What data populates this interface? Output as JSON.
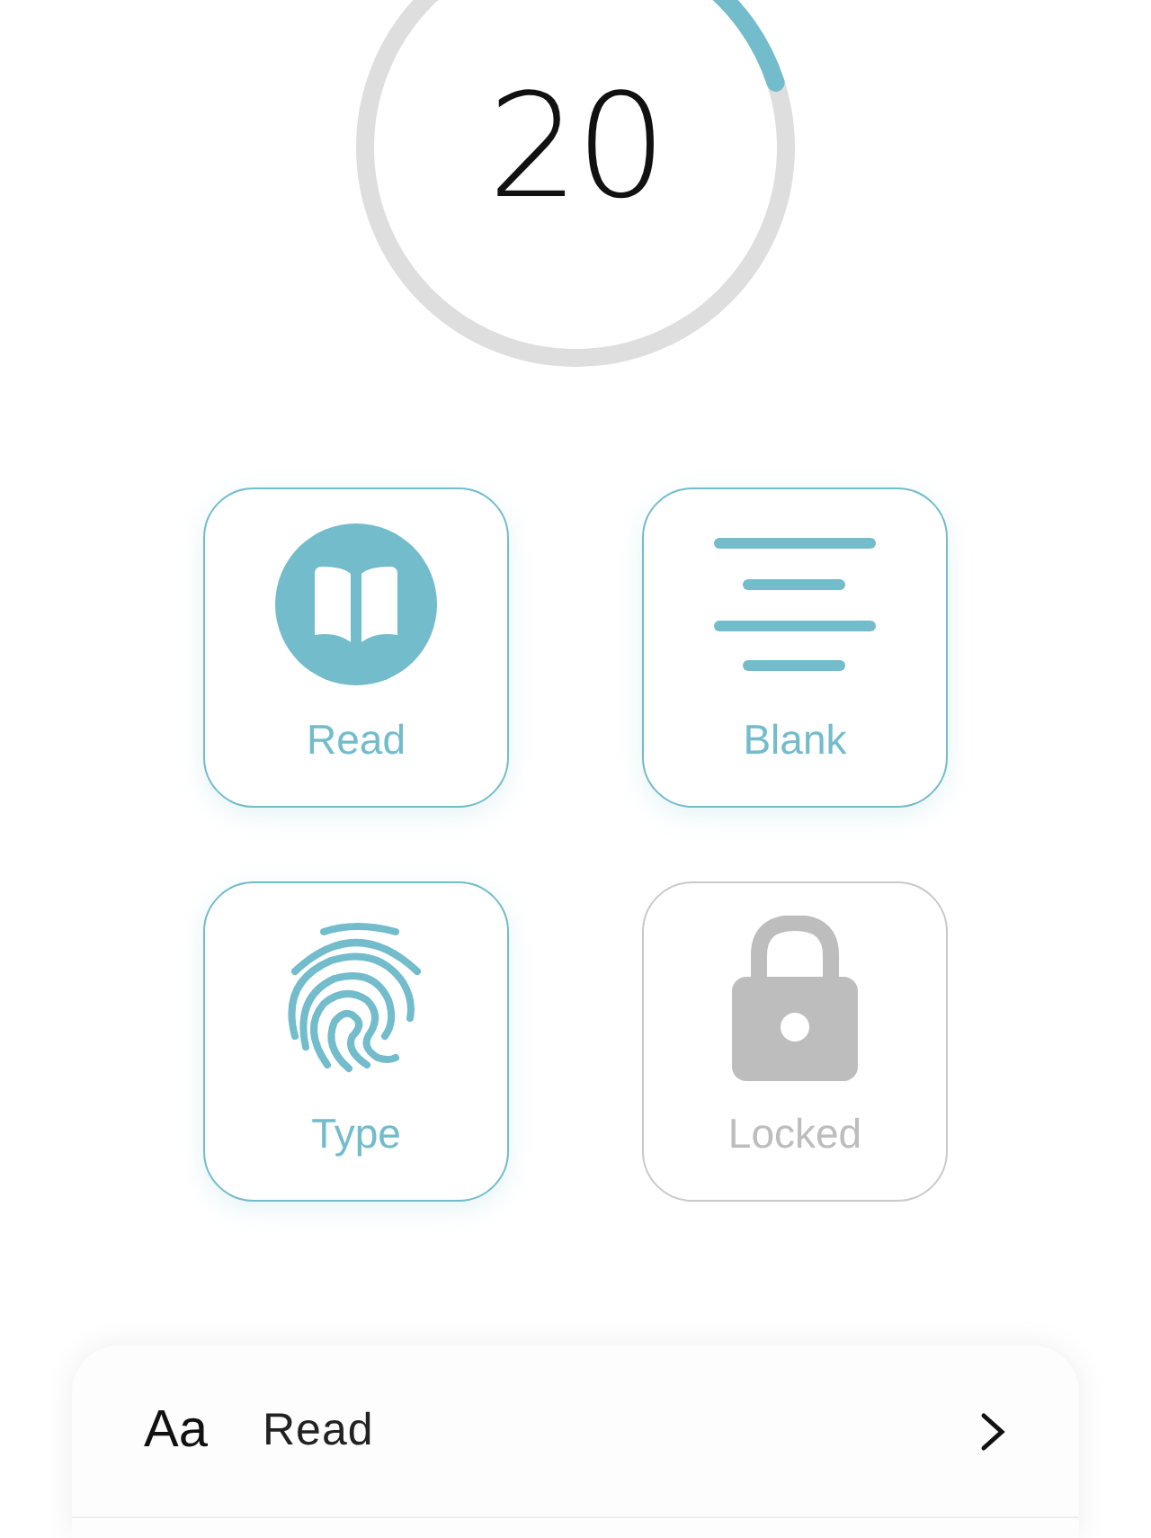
{
  "timer": {
    "value": "20"
  },
  "modes": [
    {
      "label": "Read",
      "kind": "read",
      "locked": false
    },
    {
      "label": "Blank",
      "kind": "blank",
      "locked": false
    },
    {
      "label": "Type",
      "kind": "type",
      "locked": false
    },
    {
      "label": "Locked",
      "kind": "lock",
      "locked": true
    }
  ],
  "settings": [
    {
      "symbol": "Aa",
      "label": "Read"
    }
  ]
}
